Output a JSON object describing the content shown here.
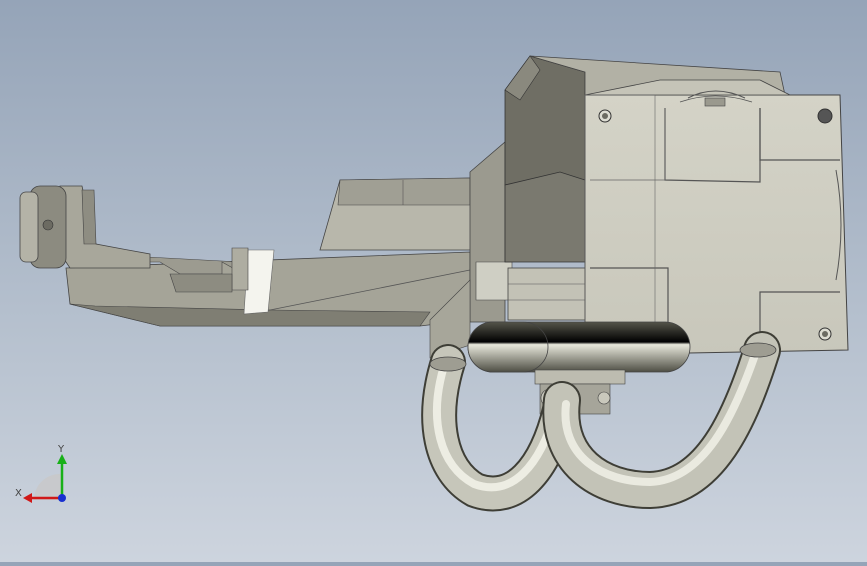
{
  "viewport": {
    "background_top": "#95a4b8",
    "background_bottom": "#cdd4de",
    "model": "weld-gun-assembly"
  },
  "triad": {
    "x_label": "X",
    "y_label": "Y",
    "x_color": "#d01818",
    "y_color": "#18b018",
    "z_color": "#1830d0"
  }
}
